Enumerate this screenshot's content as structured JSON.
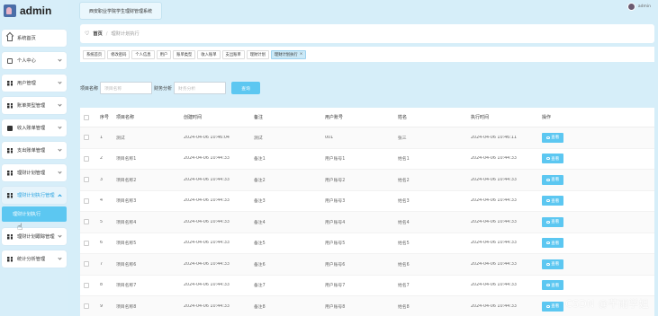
{
  "app": {
    "logo_text": "admin",
    "system_title": "西安职业学院学生理财管理系统",
    "user_name": "admin"
  },
  "sidebar": {
    "items": [
      {
        "label": "系统首页",
        "icon": "home-icon"
      },
      {
        "label": "个人中心",
        "icon": "user-icon"
      },
      {
        "label": "用户管理",
        "icon": "grid-icon"
      },
      {
        "label": "账单类型管理",
        "icon": "grid-icon"
      },
      {
        "label": "收入账单管理",
        "icon": "monitor-icon"
      },
      {
        "label": "支出账单管理",
        "icon": "grid-icon"
      },
      {
        "label": "理财计划管理",
        "icon": "grid-icon"
      },
      {
        "label": "理财计划执行管理",
        "icon": "grid-icon"
      },
      {
        "label": "理财计划跟踪管理",
        "icon": "grid-icon"
      },
      {
        "label": "统计分析管理",
        "icon": "grid-icon"
      }
    ],
    "active_sub": "理财计划执行"
  },
  "breadcrumb": {
    "home": "首页",
    "current": "理财计划执行"
  },
  "tags": [
    {
      "label": "系统首页",
      "active": false
    },
    {
      "label": "修改密码",
      "active": false
    },
    {
      "label": "个人信息",
      "active": false
    },
    {
      "label": "用户",
      "active": false
    },
    {
      "label": "账单类型",
      "active": false
    },
    {
      "label": "收入账单",
      "active": false
    },
    {
      "label": "支出账单",
      "active": false
    },
    {
      "label": "理财计划",
      "active": false
    },
    {
      "label": "理财计划执行",
      "active": true
    }
  ],
  "search": {
    "name_label": "项目名称",
    "name_placeholder": "项目名称",
    "finance_label": "财务分析",
    "finance_placeholder": "财务分析",
    "button": "查询"
  },
  "table": {
    "headers": [
      "序号",
      "项目名称",
      "创建时间",
      "备注",
      "用户账号",
      "姓名",
      "执行时间",
      "操作"
    ],
    "view_label": "查看",
    "rows": [
      {
        "idx": "1",
        "name": "测试",
        "created": "2024-04-06 10:46:04",
        "remark": "测试",
        "account": "001",
        "uname": "张三",
        "exec": "2024-04-06 10:46:11"
      },
      {
        "idx": "2",
        "name": "项目名称1",
        "created": "2024-04-06 10:44:33",
        "remark": "备注1",
        "account": "用户账号1",
        "uname": "姓名1",
        "exec": "2024-04-06 10:44:33"
      },
      {
        "idx": "3",
        "name": "项目名称2",
        "created": "2024-04-06 10:44:33",
        "remark": "备注2",
        "account": "用户账号2",
        "uname": "姓名2",
        "exec": "2024-04-06 10:44:33"
      },
      {
        "idx": "4",
        "name": "项目名称3",
        "created": "2024-04-06 10:44:33",
        "remark": "备注3",
        "account": "用户账号3",
        "uname": "姓名3",
        "exec": "2024-04-06 10:44:33"
      },
      {
        "idx": "5",
        "name": "项目名称4",
        "created": "2024-04-06 10:44:33",
        "remark": "备注4",
        "account": "用户账号4",
        "uname": "姓名4",
        "exec": "2024-04-06 10:44:33"
      },
      {
        "idx": "6",
        "name": "项目名称5",
        "created": "2024-04-06 10:44:33",
        "remark": "备注5",
        "account": "用户账号5",
        "uname": "姓名5",
        "exec": "2024-04-06 10:44:33"
      },
      {
        "idx": "7",
        "name": "项目名称6",
        "created": "2024-04-06 10:44:33",
        "remark": "备注6",
        "account": "用户账号6",
        "uname": "姓名6",
        "exec": "2024-04-06 10:44:33"
      },
      {
        "idx": "8",
        "name": "项目名称7",
        "created": "2024-04-06 10:44:33",
        "remark": "备注7",
        "account": "用户账号7",
        "uname": "姓名7",
        "exec": "2024-04-06 10:44:33"
      },
      {
        "idx": "9",
        "name": "项目名称8",
        "created": "2024-04-06 10:44:33",
        "remark": "备注8",
        "account": "用户账号8",
        "uname": "姓名8",
        "exec": "2024-04-06 10:44:33"
      }
    ]
  },
  "watermark": "CSDN @芊雨学姐",
  "colors": {
    "accent": "#5cc7f1",
    "sidebar_bg": "#d7eef9",
    "page_bg": "#d6eef9"
  }
}
